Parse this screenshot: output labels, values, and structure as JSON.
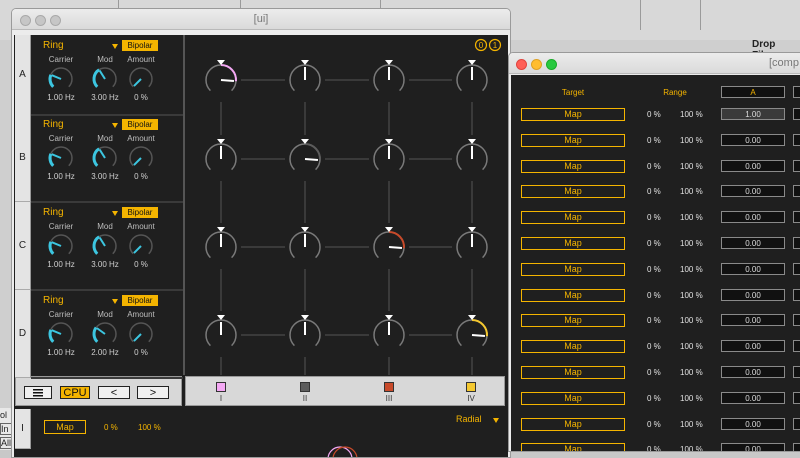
{
  "desktop": {
    "drop_label": "Drop Files"
  },
  "ui_window": {
    "title": "[ui]",
    "header_badges": [
      "0",
      "1"
    ],
    "rows": [
      {
        "label": "A",
        "mode": "Ring",
        "polarity": "Bipolar",
        "knobs": [
          {
            "label": "Carrier",
            "value": "1.00 Hz",
            "level": 0.25
          },
          {
            "label": "Mod",
            "value": "3.00 Hz",
            "level": 0.38
          },
          {
            "label": "Amount",
            "value": "0 %",
            "level": 0.0
          }
        ]
      },
      {
        "label": "B",
        "mode": "Ring",
        "polarity": "Bipolar",
        "knobs": [
          {
            "label": "Carrier",
            "value": "1.00 Hz",
            "level": 0.25
          },
          {
            "label": "Mod",
            "value": "3.00 Hz",
            "level": 0.38
          },
          {
            "label": "Amount",
            "value": "0 %",
            "level": 0.0
          }
        ]
      },
      {
        "label": "C",
        "mode": "Ring",
        "polarity": "Bipolar",
        "knobs": [
          {
            "label": "Carrier",
            "value": "1.00 Hz",
            "level": 0.25
          },
          {
            "label": "Mod",
            "value": "3.00 Hz",
            "level": 0.38
          },
          {
            "label": "Amount",
            "value": "0 %",
            "level": 0.0
          }
        ]
      },
      {
        "label": "D",
        "mode": "Ring",
        "polarity": "Bipolar",
        "knobs": [
          {
            "label": "Carrier",
            "value": "1.00 Hz",
            "level": 0.25
          },
          {
            "label": "Mod",
            "value": "2.00 Hz",
            "level": 0.3
          },
          {
            "label": "Amount",
            "value": "0 %",
            "level": 0.0
          }
        ]
      }
    ],
    "matrix": {
      "columns": [
        "I",
        "II",
        "III",
        "IV"
      ],
      "column_colors": [
        "#f4a8f4",
        "#5c5c5c",
        "#c84a2a",
        "#f4c830"
      ],
      "diagonal_levels": [
        0.45,
        0.45,
        0.45,
        0.45
      ]
    },
    "controls": {
      "menu_icon": "hamburger-icon",
      "cpu_label": "CPU",
      "prev_label": "<",
      "next_label": ">"
    },
    "bottom": {
      "row_label": "I",
      "map_label": "Map",
      "range_min": "0 %",
      "range_max": "100 %",
      "view_mode": "Radial"
    },
    "left_clip": [
      "ol",
      "In",
      "All"
    ]
  },
  "comp_window": {
    "title": "[comp",
    "headers": {
      "target": "Target",
      "range": "Range",
      "column_a": "A"
    },
    "rows": [
      {
        "map": "Map",
        "min": "0 %",
        "max": "100 %",
        "a": "1.00"
      },
      {
        "map": "Map",
        "min": "0 %",
        "max": "100 %",
        "a": "0.00"
      },
      {
        "map": "Map",
        "min": "0 %",
        "max": "100 %",
        "a": "0.00"
      },
      {
        "map": "Map",
        "min": "0 %",
        "max": "100 %",
        "a": "0.00"
      },
      {
        "map": "Map",
        "min": "0 %",
        "max": "100 %",
        "a": "0.00"
      },
      {
        "map": "Map",
        "min": "0 %",
        "max": "100 %",
        "a": "0.00"
      },
      {
        "map": "Map",
        "min": "0 %",
        "max": "100 %",
        "a": "0.00"
      },
      {
        "map": "Map",
        "min": "0 %",
        "max": "100 %",
        "a": "0.00"
      },
      {
        "map": "Map",
        "min": "0 %",
        "max": "100 %",
        "a": "0.00"
      },
      {
        "map": "Map",
        "min": "0 %",
        "max": "100 %",
        "a": "0.00"
      },
      {
        "map": "Map",
        "min": "0 %",
        "max": "100 %",
        "a": "0.00"
      },
      {
        "map": "Map",
        "min": "0 %",
        "max": "100 %",
        "a": "0.00"
      },
      {
        "map": "Map",
        "min": "0 %",
        "max": "100 %",
        "a": "0.00"
      },
      {
        "map": "Map",
        "min": "0 %",
        "max": "100 %",
        "a": "0.00"
      }
    ]
  },
  "colors": {
    "accent": "#f4b400",
    "knob_cyan": "#3cc6e0",
    "device_bg": "#1f1f1f"
  }
}
